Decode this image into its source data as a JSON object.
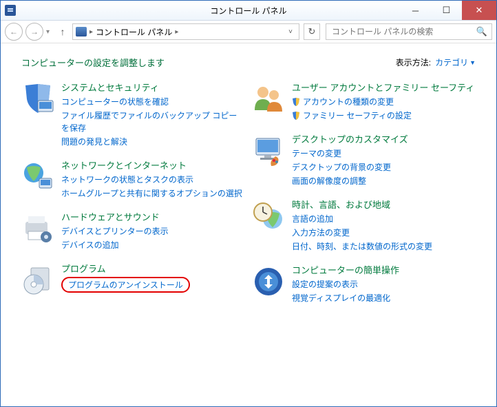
{
  "window": {
    "title": "コントロール パネル"
  },
  "nav": {
    "breadcrumb": "コントロール パネル",
    "search_placeholder": "コントロール パネルの検索"
  },
  "content": {
    "heading": "コンピューターの設定を調整します",
    "view_label": "表示方法:",
    "view_value": "カテゴリ"
  },
  "left": [
    {
      "title": "システムとセキュリティ",
      "links": [
        "コンピューターの状態を確認",
        "ファイル履歴でファイルのバックアップ コピーを保存",
        "問題の発見と解決"
      ]
    },
    {
      "title": "ネットワークとインターネット",
      "links": [
        "ネットワークの状態とタスクの表示",
        "ホームグループと共有に関するオプションの選択"
      ]
    },
    {
      "title": "ハードウェアとサウンド",
      "links": [
        "デバイスとプリンターの表示",
        "デバイスの追加"
      ]
    },
    {
      "title": "プログラム",
      "links": [
        "プログラムのアンインストール"
      ]
    }
  ],
  "right": [
    {
      "title": "ユーザー アカウントとファミリー セーフティ",
      "links": [
        "アカウントの種類の変更",
        "ファミリー セーフティの設定"
      ]
    },
    {
      "title": "デスクトップのカスタマイズ",
      "links": [
        "テーマの変更",
        "デスクトップの背景の変更",
        "画面の解像度の調整"
      ]
    },
    {
      "title": "時計、言語、および地域",
      "links": [
        "言語の追加",
        "入力方法の変更",
        "日付、時刻、または数値の形式の変更"
      ]
    },
    {
      "title": "コンピューターの簡単操作",
      "links": [
        "設定の提案の表示",
        "視覚ディスプレイの最適化"
      ]
    }
  ]
}
